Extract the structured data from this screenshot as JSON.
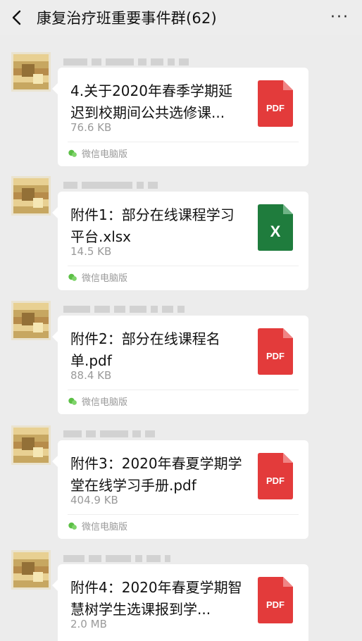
{
  "header": {
    "title": "康复治疗班重要事件群(62)",
    "back_icon": "chevron-left-icon",
    "more_icon": "more-dots-icon"
  },
  "colors": {
    "pdf_red": "#e33b3b",
    "excel_green": "#1f7c3d",
    "background": "#ececec",
    "card": "#ffffff"
  },
  "messages": [
    {
      "file_name": "4.关于2020年春季学期延迟到校期间公共选修课...",
      "file_size": "76.6 KB",
      "file_type": "pdf",
      "icon_label": "PDF",
      "source": "微信电脑版"
    },
    {
      "file_name": "附件1：部分在线课程学习平台.xlsx",
      "file_size": "14.5 KB",
      "file_type": "xlsx",
      "icon_label": "X",
      "source": "微信电脑版"
    },
    {
      "file_name": "附件2：部分在线课程名单.pdf",
      "file_size": "88.4 KB",
      "file_type": "pdf",
      "icon_label": "PDF",
      "source": "微信电脑版"
    },
    {
      "file_name": "附件3：2020年春夏学期学堂在线学习手册.pdf",
      "file_size": "404.9 KB",
      "file_type": "pdf",
      "icon_label": "PDF",
      "source": "微信电脑版"
    },
    {
      "file_name": "附件4：2020年春夏学期智慧树学生选课报到学...",
      "file_size": "2.0 MB",
      "file_type": "pdf",
      "icon_label": "PDF",
      "source": ""
    }
  ]
}
